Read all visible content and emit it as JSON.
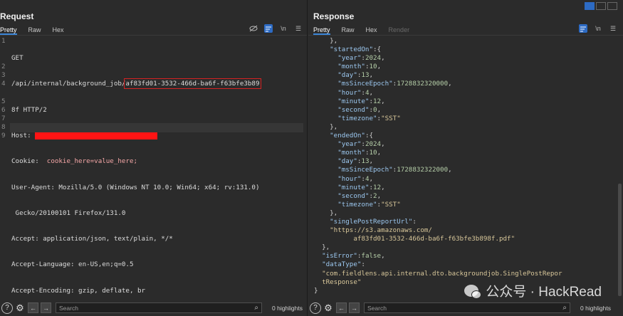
{
  "request": {
    "title": "Request",
    "tabs": [
      "Pretty",
      "Raw",
      "Hex"
    ],
    "line_numbers": [
      "1",
      "",
      "",
      "2",
      "3",
      "4",
      "",
      "5",
      "6",
      "7",
      "8",
      "9"
    ],
    "lines": {
      "l1a": "GET",
      "l1b_prefix": "/api/internal/background_job/",
      "l1b_id": "af83fd01-3532-466d-ba6f-f63bfe3b89",
      "l1c": "8f HTTP/2",
      "l2": "Host: ",
      "l3_key": "Cookie: ",
      "l3_val": " cookie_here=value_here;",
      "l4a": "User-Agent: Mozilla/5.0 (Windows NT 10.0; Win64; x64; rv:131.0)",
      "l4b": " Gecko/20100101 Firefox/131.0",
      "l5": "Accept: application/json, text/plain, */*",
      "l6": "Accept-Language: en-US,en;q=0.5",
      "l7": "Accept-Encoding: gzip, deflate, br"
    },
    "search_placeholder": "Search",
    "highlights": "0 highlights"
  },
  "response": {
    "title": "Response",
    "tabs": [
      "Pretty",
      "Raw",
      "Hex",
      "Render"
    ],
    "search_placeholder": "Search",
    "highlights": "0 highlights",
    "json_lines": [
      {
        "indent": 1,
        "parts": [
          [
            "p",
            "},"
          ]
        ]
      },
      {
        "indent": 1,
        "parts": [
          [
            "k",
            "\"startedOn\""
          ],
          [
            "p",
            ":{"
          ]
        ]
      },
      {
        "indent": 2,
        "parts": [
          [
            "k",
            "\"year\""
          ],
          [
            "p",
            ":"
          ],
          [
            "n",
            "2024"
          ],
          [
            "p",
            ","
          ]
        ]
      },
      {
        "indent": 2,
        "parts": [
          [
            "k",
            "\"month\""
          ],
          [
            "p",
            ":"
          ],
          [
            "n",
            "10"
          ],
          [
            "p",
            ","
          ]
        ]
      },
      {
        "indent": 2,
        "parts": [
          [
            "k",
            "\"day\""
          ],
          [
            "p",
            ":"
          ],
          [
            "n",
            "13"
          ],
          [
            "p",
            ","
          ]
        ]
      },
      {
        "indent": 2,
        "parts": [
          [
            "k",
            "\"msSinceEpoch\""
          ],
          [
            "p",
            ":"
          ],
          [
            "n",
            "1728832320000"
          ],
          [
            "p",
            ","
          ]
        ]
      },
      {
        "indent": 2,
        "parts": [
          [
            "k",
            "\"hour\""
          ],
          [
            "p",
            ":"
          ],
          [
            "n",
            "4"
          ],
          [
            "p",
            ","
          ]
        ]
      },
      {
        "indent": 2,
        "parts": [
          [
            "k",
            "\"minute\""
          ],
          [
            "p",
            ":"
          ],
          [
            "n",
            "12"
          ],
          [
            "p",
            ","
          ]
        ]
      },
      {
        "indent": 2,
        "parts": [
          [
            "k",
            "\"second\""
          ],
          [
            "p",
            ":"
          ],
          [
            "n",
            "0"
          ],
          [
            "p",
            ","
          ]
        ]
      },
      {
        "indent": 2,
        "parts": [
          [
            "k",
            "\"timezone\""
          ],
          [
            "p",
            ":"
          ],
          [
            "s",
            "\"SST\""
          ]
        ]
      },
      {
        "indent": 1,
        "parts": [
          [
            "p",
            "},"
          ]
        ]
      },
      {
        "indent": 1,
        "parts": [
          [
            "k",
            "\"endedOn\""
          ],
          [
            "p",
            ":{"
          ]
        ]
      },
      {
        "indent": 2,
        "parts": [
          [
            "k",
            "\"year\""
          ],
          [
            "p",
            ":"
          ],
          [
            "n",
            "2024"
          ],
          [
            "p",
            ","
          ]
        ]
      },
      {
        "indent": 2,
        "parts": [
          [
            "k",
            "\"month\""
          ],
          [
            "p",
            ":"
          ],
          [
            "n",
            "10"
          ],
          [
            "p",
            ","
          ]
        ]
      },
      {
        "indent": 2,
        "parts": [
          [
            "k",
            "\"day\""
          ],
          [
            "p",
            ":"
          ],
          [
            "n",
            "13"
          ],
          [
            "p",
            ","
          ]
        ]
      },
      {
        "indent": 2,
        "parts": [
          [
            "k",
            "\"msSinceEpoch\""
          ],
          [
            "p",
            ":"
          ],
          [
            "n",
            "1728832322000"
          ],
          [
            "p",
            ","
          ]
        ]
      },
      {
        "indent": 2,
        "parts": [
          [
            "k",
            "\"hour\""
          ],
          [
            "p",
            ":"
          ],
          [
            "n",
            "4"
          ],
          [
            "p",
            ","
          ]
        ]
      },
      {
        "indent": 2,
        "parts": [
          [
            "k",
            "\"minute\""
          ],
          [
            "p",
            ":"
          ],
          [
            "n",
            "12"
          ],
          [
            "p",
            ","
          ]
        ]
      },
      {
        "indent": 2,
        "parts": [
          [
            "k",
            "\"second\""
          ],
          [
            "p",
            ":"
          ],
          [
            "n",
            "2"
          ],
          [
            "p",
            ","
          ]
        ]
      },
      {
        "indent": 2,
        "parts": [
          [
            "k",
            "\"timezone\""
          ],
          [
            "p",
            ":"
          ],
          [
            "s",
            "\"SST\""
          ]
        ]
      },
      {
        "indent": 1,
        "parts": [
          [
            "p",
            "},"
          ]
        ]
      },
      {
        "indent": 1,
        "parts": [
          [
            "k",
            "\"singlePostReportUrl\""
          ],
          [
            "p",
            ":"
          ]
        ]
      },
      {
        "indent": 1,
        "parts": [
          [
            "s",
            "\"https://s3.amazonaws.com/"
          ]
        ]
      },
      {
        "indent": 3,
        "parts": [
          [
            "s",
            "af83fd01-3532-466d-ba6f-f63bfe3b898f.pdf\""
          ]
        ]
      },
      {
        "indent": 0,
        "parts": [
          [
            "p",
            "},"
          ]
        ]
      },
      {
        "indent": 0,
        "parts": [
          [
            "k",
            "\"isError\""
          ],
          [
            "p",
            ":"
          ],
          [
            "n",
            "false"
          ],
          [
            "p",
            ","
          ]
        ]
      },
      {
        "indent": 0,
        "parts": [
          [
            "k",
            "\"dataType\""
          ],
          [
            "p",
            ":"
          ]
        ]
      },
      {
        "indent": 0,
        "parts": [
          [
            "s",
            "\"com.fieldlens.api.internal.dto.backgroundjob.SinglePostRepor"
          ]
        ]
      },
      {
        "indent": 0,
        "parts": [
          [
            "s",
            "tResponse\""
          ]
        ]
      },
      {
        "indent": -1,
        "parts": [
          [
            "p",
            "}"
          ]
        ]
      }
    ]
  },
  "watermark": {
    "text": "公众号 · HackRead"
  }
}
